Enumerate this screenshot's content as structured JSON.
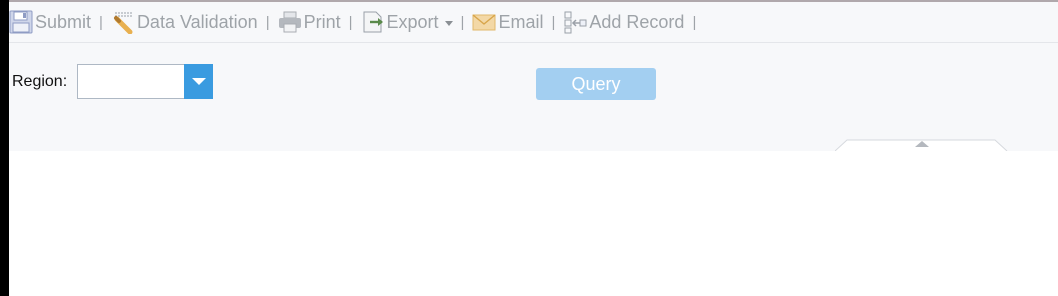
{
  "toolbar": {
    "items": [
      {
        "label": "Submit",
        "icon": "save-icon"
      },
      {
        "label": "Data Validation",
        "icon": "data-validation-icon"
      },
      {
        "label": "Print",
        "icon": "printer-icon"
      },
      {
        "label": "Export",
        "icon": "export-icon"
      },
      {
        "label": "Email",
        "icon": "envelope-icon"
      },
      {
        "label": "Add Record",
        "icon": "add-record-icon"
      }
    ],
    "separator": "|"
  },
  "params": {
    "region_label": "Region:",
    "region_value": "",
    "query_label": "Query"
  },
  "colors": {
    "accent": "#3a9be0",
    "query_button": "#a3cff1",
    "toolbar_text": "#9ea3a8"
  }
}
